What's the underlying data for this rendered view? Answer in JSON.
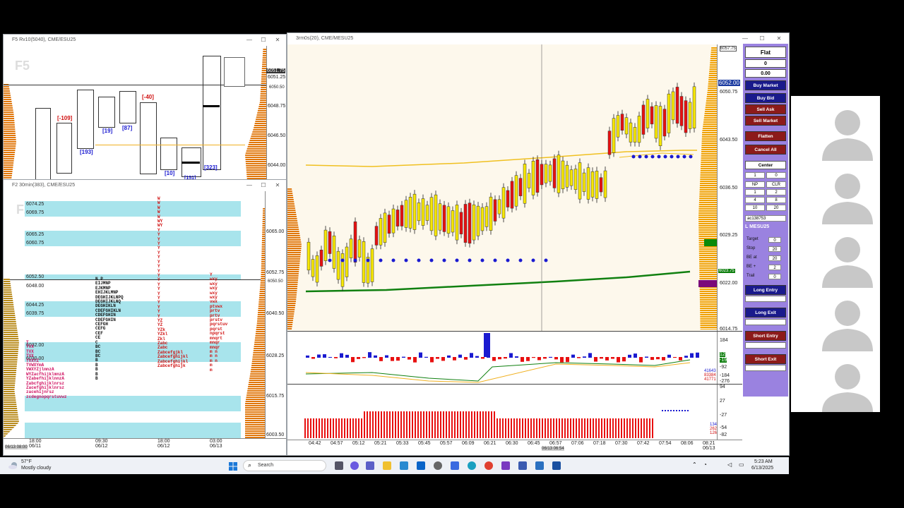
{
  "windows": {
    "top_left": {
      "title": "F5 Rv10(5040), CME/ESU25",
      "watermark": "F5",
      "prices": [
        "6051.75",
        "6051.25",
        "6050.50",
        "6048.75",
        "6046.50",
        "6044.00"
      ],
      "deltas": [
        "[-109]",
        "[193]",
        "[19]",
        "[87]",
        "[-40]",
        "[10]",
        "[323]",
        "[151]"
      ]
    },
    "bottom_left": {
      "title": "F2 30min(383), CME/ESU25",
      "watermark": "F2",
      "levels": [
        "6074.25",
        "6069.75",
        "6065.25",
        "6060.75",
        "6052.50",
        "6048.00",
        "6044.25",
        "6039.75",
        "6032.00",
        "6030.00"
      ],
      "axis_prices": [
        "6065.00",
        "6052.75",
        "6050.50",
        "6040.50",
        "6028.25",
        "6015.75",
        "6003.50"
      ],
      "x_labels": [
        "18:00\n06/11",
        "09:30\n06/12",
        "18:00\n06/12",
        "03:00\n06/13"
      ],
      "corner_label": "06/13 08:00"
    },
    "main": {
      "title": "3rm0s(20), CME/MESU25",
      "axis_prices": [
        "6057.75",
        "6052.00",
        "6050.75",
        "6043.50",
        "6036.50",
        "6029.25",
        "6023.75",
        "6022.00",
        "6014.75"
      ],
      "x_labels": [
        "04:42",
        "04:57",
        "05:12",
        "05:21",
        "05:33",
        "05:45",
        "05:57",
        "06:09",
        "06:21",
        "06:30",
        "06:45",
        "06:57",
        "07:06",
        "07:18",
        "07:30",
        "07:42",
        "07:54",
        "08:06",
        "08:21\n06/13"
      ],
      "cursor_label": "06/13 06:54",
      "ind1_axis": [
        "184",
        "12",
        "-19",
        "-92",
        "-184",
        "-276",
        "41643",
        "83384",
        "41771"
      ],
      "ind2_axis": [
        "94",
        "27",
        "-27",
        "-54",
        "-82",
        "134",
        "262",
        "126"
      ]
    }
  },
  "order_panel": {
    "position": "Flat",
    "qty": "0",
    "pnl": "0.00",
    "buy_market": "Buy Market",
    "buy_bid": "Buy Bid",
    "sell_ask": "Sell Ask",
    "sell_market": "Sell Market",
    "flatten": "Flatten",
    "cancel_all": "Cancel All",
    "center": "Center",
    "qty_input": "1",
    "qty_right": "0",
    "grid": [
      "NP",
      "CLR",
      "1",
      "2",
      "4",
      "8",
      "10",
      "20"
    ],
    "account": "ac138753",
    "symbol": "L MESU25",
    "params": [
      {
        "label": "Target",
        "value": "0"
      },
      {
        "label": "Stop",
        "value": "20"
      },
      {
        "label": "BE at",
        "value": "20"
      },
      {
        "label": "BE +",
        "value": "2"
      },
      {
        "label": "Trail",
        "value": "0"
      }
    ],
    "long_entry": "Long Entry",
    "long_exit": "Long Exit",
    "short_entry": "Short Entry",
    "short_exit": "Short Exit",
    "colors": {
      "buy": "#1a1a8c",
      "sell": "#8c1a1a",
      "panel": "#9a82e0"
    }
  },
  "taskbar": {
    "temp": "57°F",
    "weather": "Mostly cloudy",
    "search": "Search",
    "time": "5:23 AM",
    "date": "6/13/2025"
  }
}
